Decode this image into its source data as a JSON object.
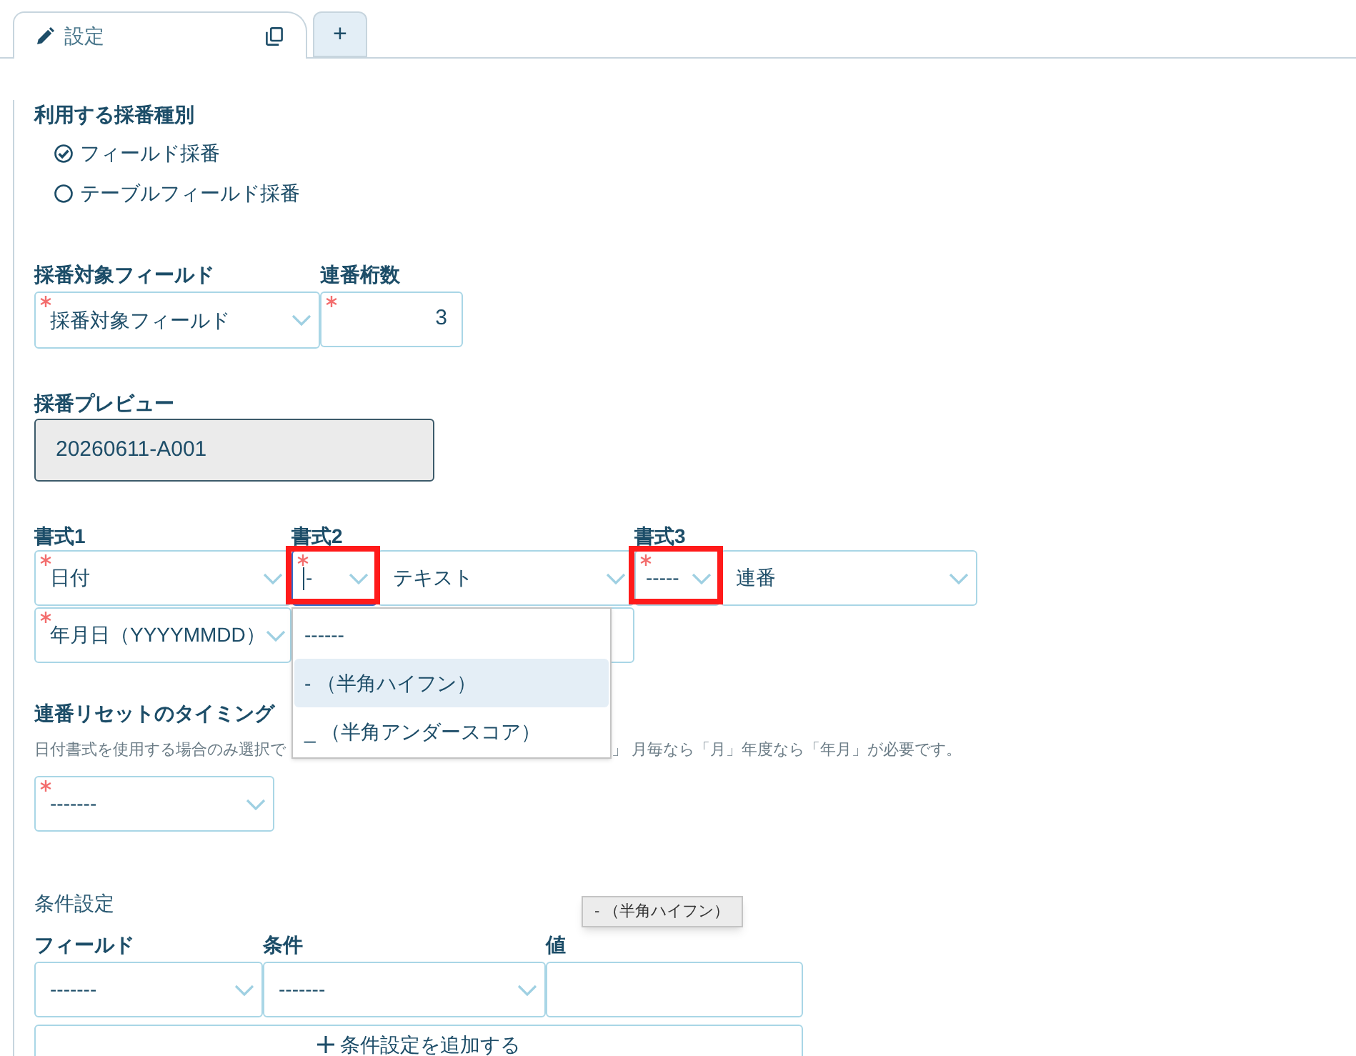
{
  "tabs": [
    {
      "kind": "edit",
      "label": "設定",
      "selected": true
    },
    {
      "kind": "add",
      "label": "+",
      "selected": false
    }
  ],
  "numbering_type": {
    "label": "利用する採番種別",
    "options": [
      {
        "label": "フィールド採番",
        "selected": true
      },
      {
        "label": "テーブルフィールド採番",
        "selected": false
      }
    ]
  },
  "target_field": {
    "label": "採番対象フィールド",
    "value": "採番対象フィールド",
    "required": true
  },
  "digits": {
    "label": "連番桁数",
    "value": "3",
    "required": true
  },
  "preview": {
    "label": "採番プレビュー",
    "value": "20260611-A001"
  },
  "formats": [
    {
      "label": "書式1",
      "rows": [
        [
          {
            "kind": "select",
            "value": "日付",
            "required": true,
            "highlighted": false,
            "focused": false
          }
        ],
        [
          {
            "kind": "select",
            "value": "年月日（YYYYMMDD）",
            "required": true,
            "highlighted": false,
            "focused": false
          }
        ]
      ]
    },
    {
      "label": "書式2",
      "rows": [
        [
          {
            "kind": "separator",
            "value": "-",
            "required": true,
            "highlighted": true,
            "focused": true,
            "dropdown": {
              "options": [
                {
                  "label": "------",
                  "selected": false
                },
                {
                  "label": "- （半角ハイフン）",
                  "selected": true
                },
                {
                  "label": "_ （半角アンダースコア）",
                  "selected": false
                }
              ]
            }
          },
          {
            "kind": "select",
            "value": "テキスト",
            "required": false,
            "highlighted": false,
            "focused": false
          }
        ],
        [
          {
            "kind": "input"
          }
        ]
      ]
    },
    {
      "label": "書式3",
      "rows": [
        [
          {
            "kind": "separator",
            "value": "-----",
            "required": true,
            "highlighted": true,
            "focused": false
          },
          {
            "kind": "select",
            "value": "連番",
            "required": false,
            "highlighted": false,
            "focused": false
          }
        ]
      ]
    }
  ],
  "reset_timing": {
    "label": "連番リセットのタイミング",
    "hint_visible_parts": [
      "日付書式を使用する場合のみ選択で",
      "」 月毎なら「月」年度なら「年月」が必要です。"
    ],
    "value": "-------",
    "required": true
  },
  "conditions": {
    "title": "条件設定",
    "columns": [
      "フィールド",
      "条件",
      "値"
    ],
    "rows": [
      {
        "cells": [
          {
            "kind": "select",
            "value": "-------"
          },
          {
            "kind": "select",
            "value": "-------"
          },
          {
            "kind": "input"
          }
        ]
      }
    ],
    "add_button": "条件設定を追加する"
  },
  "tooltip": "- （半角ハイフン）"
}
